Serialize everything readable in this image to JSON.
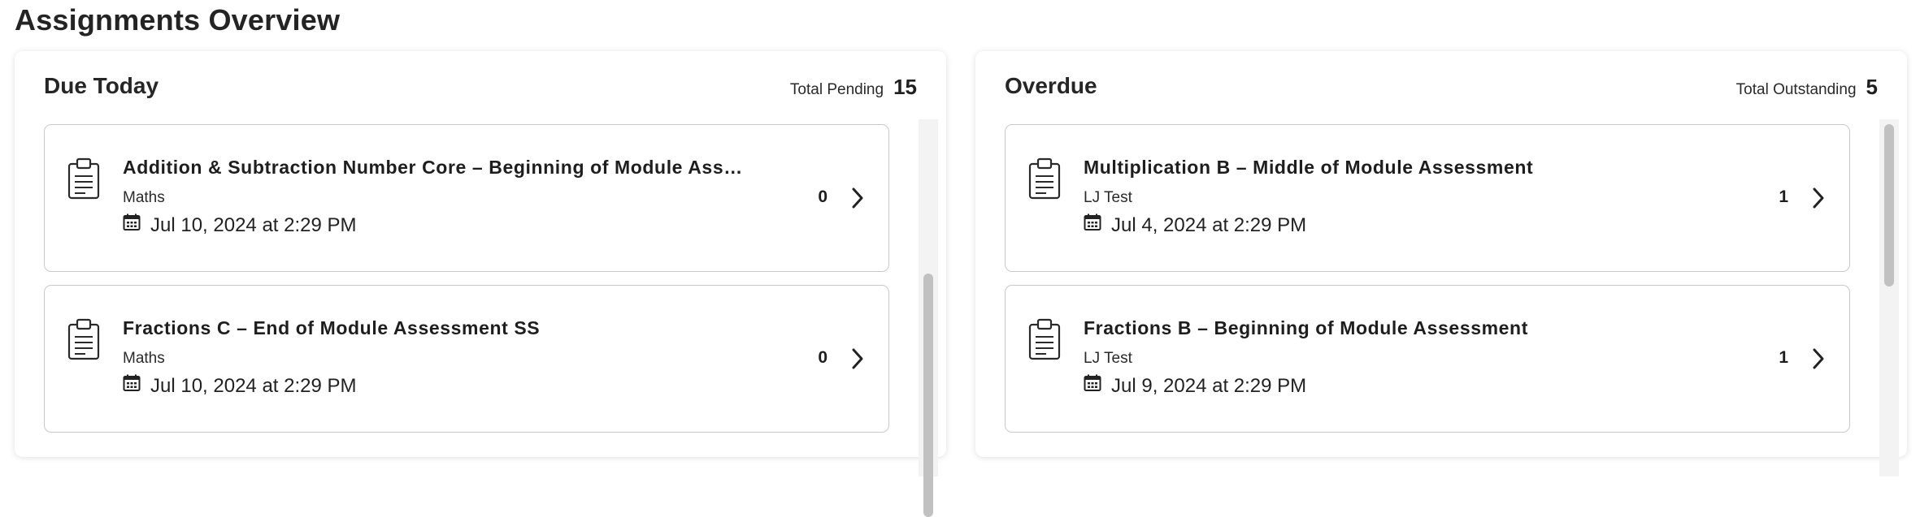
{
  "page": {
    "title": "Assignments Overview"
  },
  "due_today": {
    "title": "Due Today",
    "total_label": "Total Pending",
    "total_count": "15",
    "items": [
      {
        "title": "Addition & Subtraction Number Core – Beginning of Module Ass…",
        "subject": "Maths",
        "date": "Jul 10, 2024 at 2:29 PM",
        "count": "0"
      },
      {
        "title": "Fractions C – End of Module Assessment SS",
        "subject": "Maths",
        "date": "Jul 10, 2024 at 2:29 PM",
        "count": "0"
      }
    ]
  },
  "overdue": {
    "title": "Overdue",
    "total_label": "Total Outstanding",
    "total_count": "5",
    "items": [
      {
        "title": "Multiplication B – Middle of Module Assessment",
        "subject": "LJ Test",
        "date": "Jul 4, 2024 at 2:29 PM",
        "count": "1"
      },
      {
        "title": "Fractions B – Beginning of Module Assessment",
        "subject": "LJ Test",
        "date": "Jul 9, 2024 at 2:29 PM",
        "count": "1"
      }
    ]
  },
  "icons": {
    "assignment": "clipboard-icon",
    "date": "calendar-icon",
    "open": "chevron-right-icon"
  },
  "colors": {
    "card_border": "#c9c9c9",
    "text": "#1f1f1f",
    "scroll_thumb": "#c1c1c1"
  }
}
